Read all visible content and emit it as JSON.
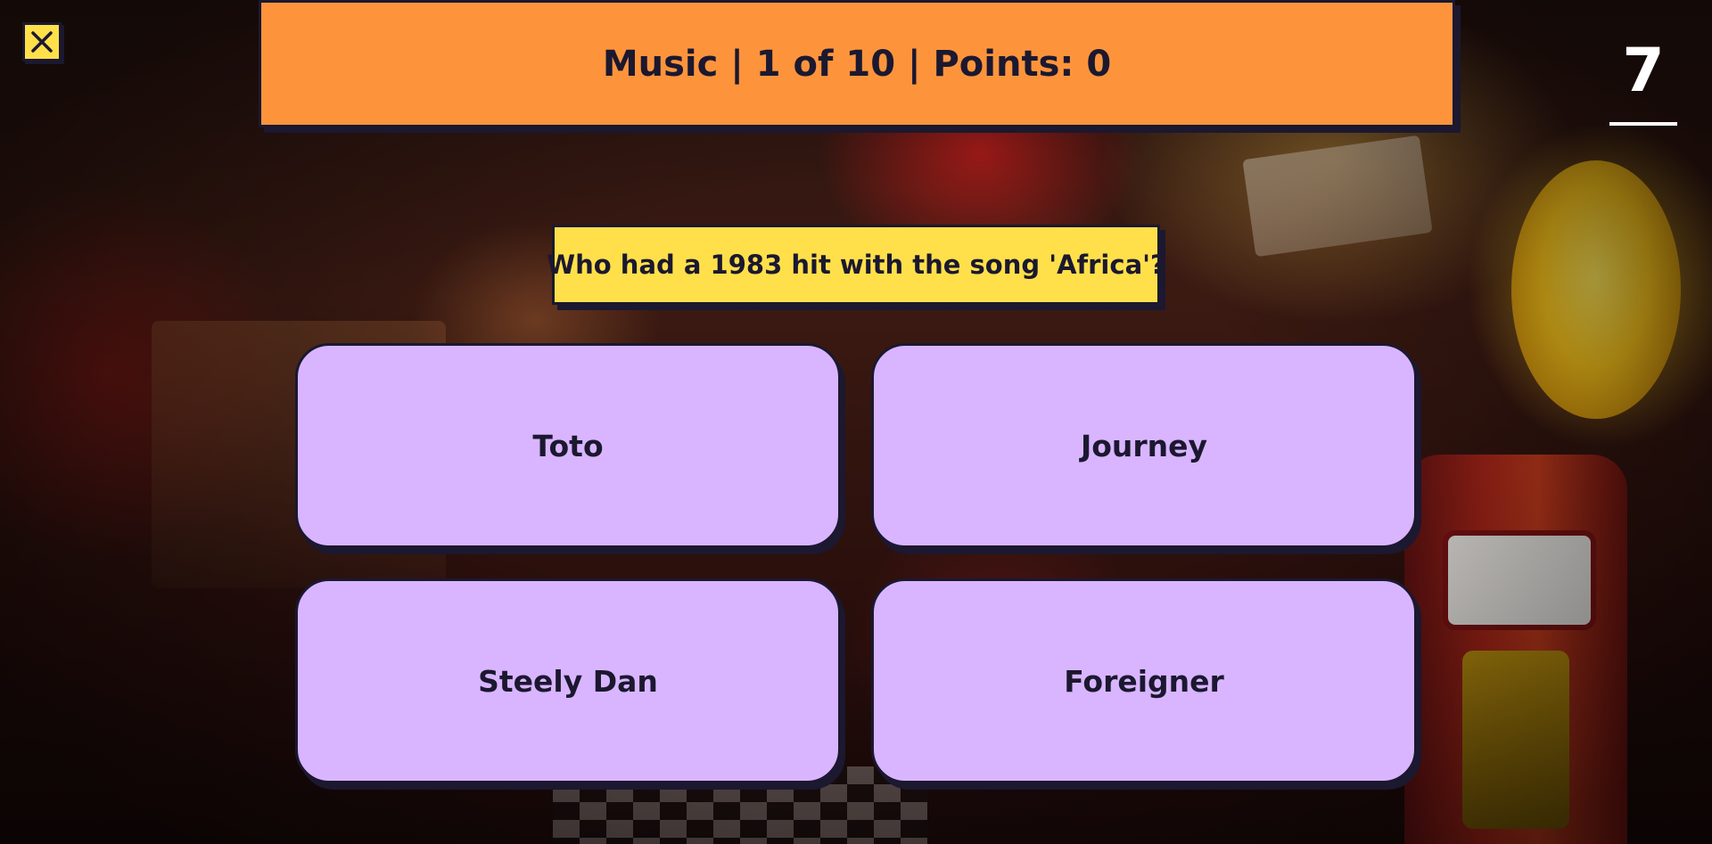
{
  "header": {
    "category": "Music",
    "progress": "1 of 10",
    "points_label": "Points: 0",
    "text": "Music | 1 of 10 | Points: 0"
  },
  "timer": {
    "value": "7"
  },
  "question": {
    "text": "Who had a 1983 hit with the song 'Africa'?"
  },
  "answers": [
    {
      "label": "Toto"
    },
    {
      "label": "Journey"
    },
    {
      "label": "Steely Dan"
    },
    {
      "label": "Foreigner"
    }
  ],
  "controls": {
    "close_icon": "close-icon"
  },
  "colors": {
    "header_bg": "#fd943c",
    "question_bg": "#ffe04a",
    "answer_bg": "#d9b5ff",
    "close_bg": "#ffe04a",
    "outline": "#1b1830",
    "timer_text": "#ffffff"
  }
}
